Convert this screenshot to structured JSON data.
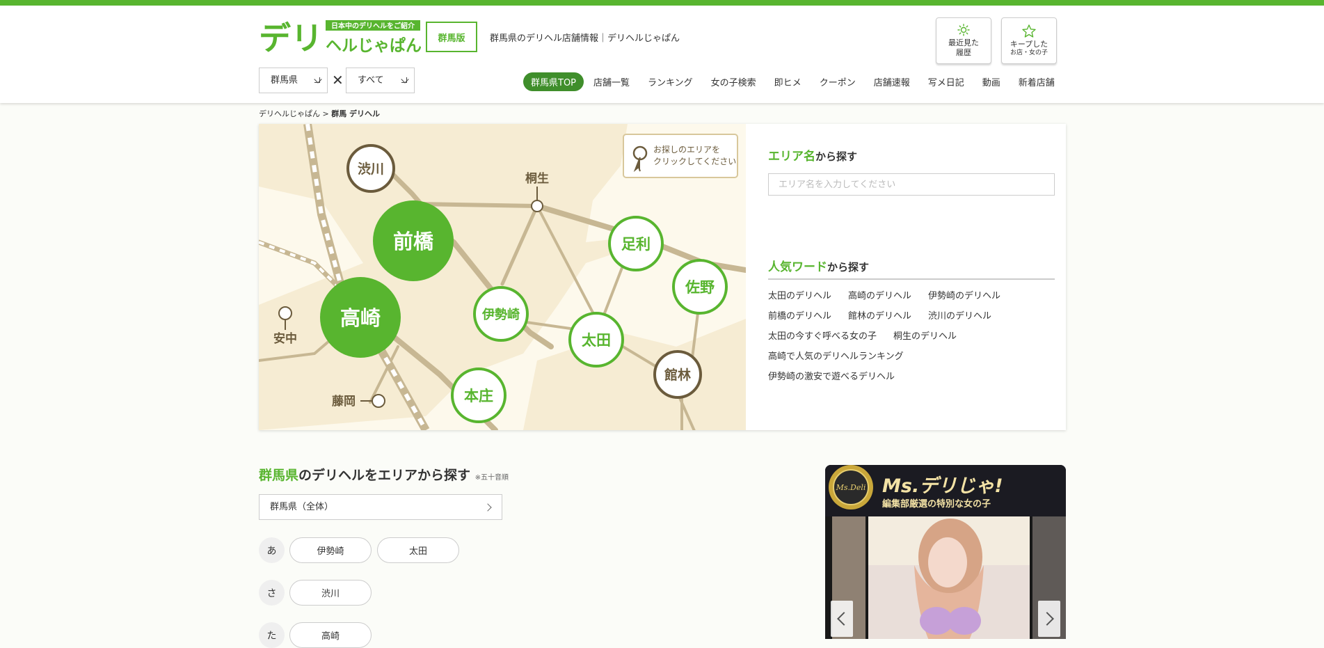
{
  "brand": {
    "logo_main": "デリ",
    "logo_sub": "ヘルじゃぱん!",
    "logo_tag": "日本中のデリヘルをご紹介",
    "region_badge": "群馬版",
    "tagline": "群馬県のデリヘル店舗情報｜デリヘルじゃぱん"
  },
  "header_buttons": {
    "recent": {
      "line1": "最近見た",
      "line2": "履歴"
    },
    "kept": {
      "line1": "キープした",
      "line2": "お店・女の子"
    }
  },
  "filters": {
    "pref": "群馬県",
    "genre": "すべて",
    "cross": "✕"
  },
  "nav": [
    "群馬県TOP",
    "店舗一覧",
    "ランキング",
    "女の子検索",
    "即ヒメ",
    "クーポン",
    "店舗速報",
    "写メ日記",
    "動画",
    "新着店舗"
  ],
  "breadcrumb": {
    "home": "デリヘルじゃぱん",
    "sep": ">",
    "current": "群馬 デリヘル"
  },
  "map": {
    "hint": [
      "お探しのエリアを",
      "クリックしてください"
    ],
    "big_areas": [
      "前橋",
      "高崎"
    ],
    "mid_areas": [
      "足利",
      "佐野",
      "伊勢崎",
      "太田",
      "本庄"
    ],
    "brown_areas": [
      "渋川",
      "館林"
    ],
    "point_labels": [
      "桐生",
      "安中",
      "藤岡"
    ]
  },
  "area_search": {
    "title_hl": "エリア名",
    "title_rest": "から探す",
    "placeholder": "エリア名を入力してください"
  },
  "popular": {
    "title_hl": "人気ワード",
    "title_rest": "から探す",
    "words": [
      "太田のデリヘル",
      "高崎のデリヘル",
      "伊勢崎のデリヘル",
      "前橋のデリヘル",
      "館林のデリヘル",
      "渋川のデリヘル",
      "太田の今すぐ呼べる女の子",
      "桐生のデリヘル",
      "高崎で人気のデリヘルランキング",
      "伊勢崎の激安で遊べるデリヘル"
    ]
  },
  "area_list": {
    "title_hl": "群馬県",
    "title_rest": "のデリヘルをエリアから探す",
    "note": "※五十音順",
    "all_label": "群馬県（全体）",
    "rows": [
      {
        "kana": "あ",
        "items": [
          "伊勢崎",
          "太田"
        ]
      },
      {
        "kana": "さ",
        "items": [
          "渋川"
        ]
      },
      {
        "kana": "た",
        "items": [
          "高崎"
        ]
      }
    ]
  },
  "banner": {
    "seal": "Ms.Deli",
    "title": "Ms.デリじゃ!",
    "subtitle": "編集部厳選の特別な女の子"
  },
  "colors": {
    "accent": "#58b52f",
    "accent_dark": "#3f8e2b",
    "map_brown": "#6b5b3c"
  }
}
